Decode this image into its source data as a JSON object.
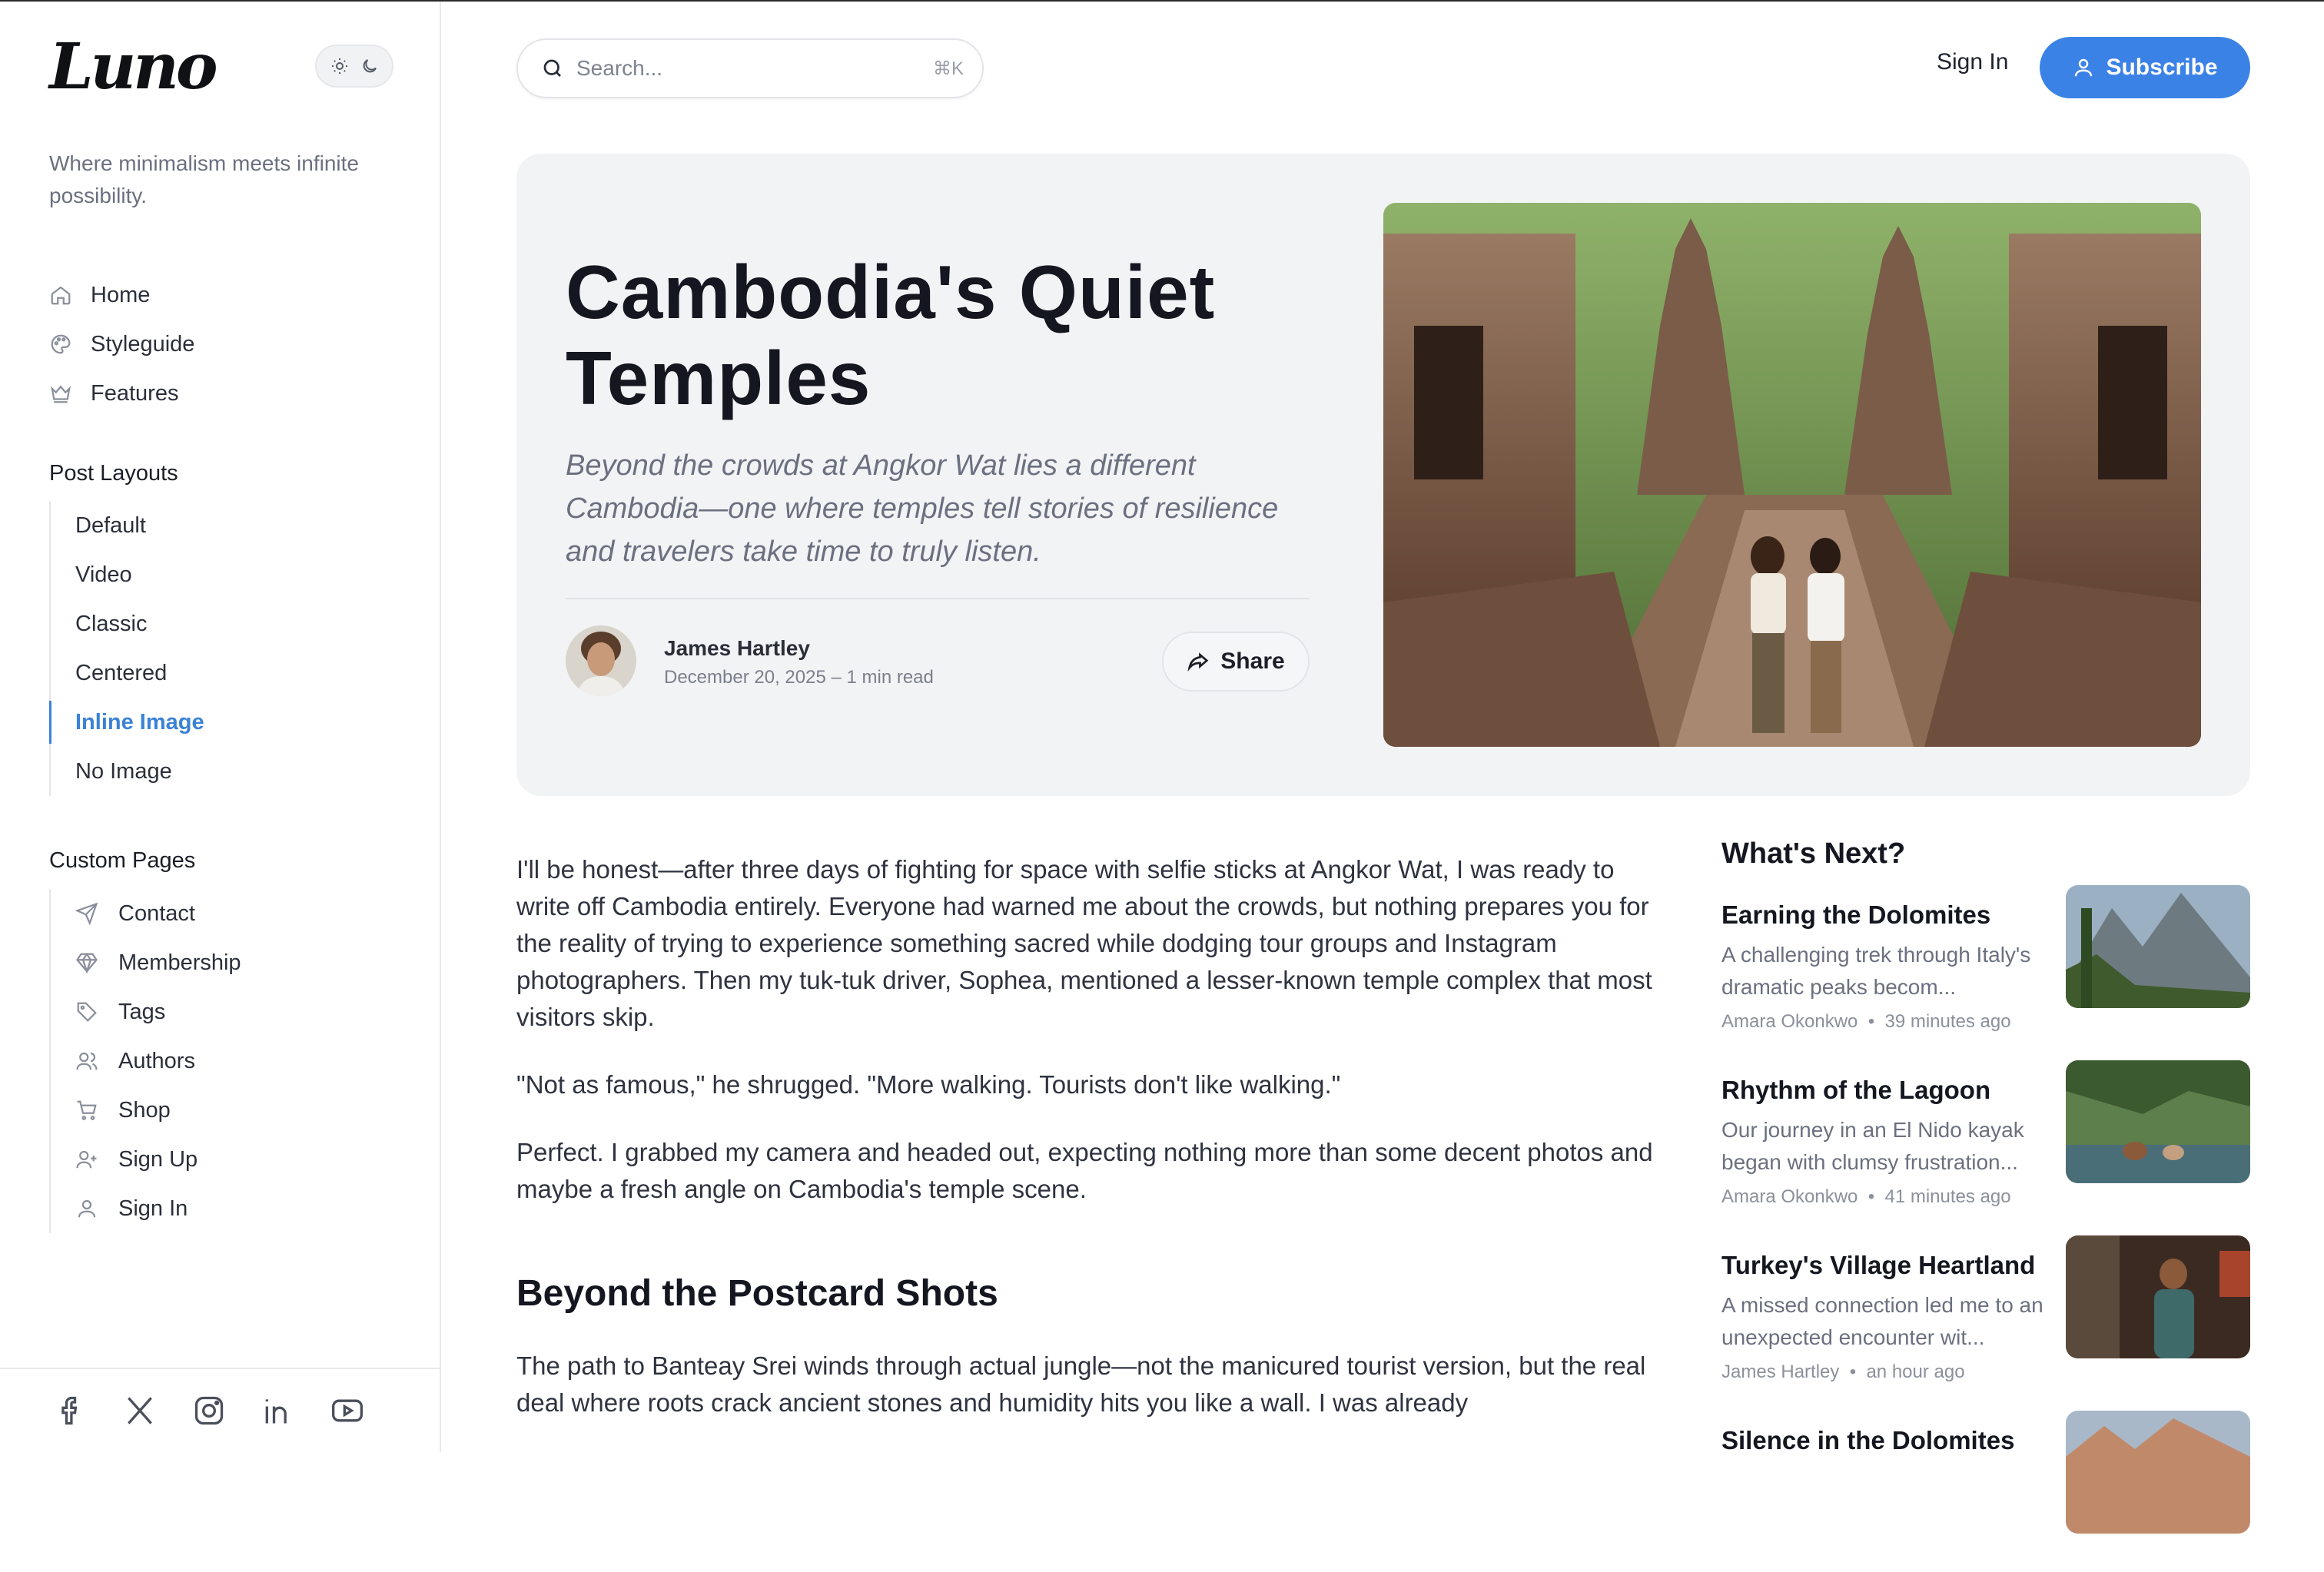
{
  "brand": {
    "logo_text": "Luno",
    "tagline": "Where minimalism meets infinite possibility."
  },
  "sidebar": {
    "main_nav": [
      {
        "label": "Home",
        "icon": "home-icon"
      },
      {
        "label": "Styleguide",
        "icon": "palette-icon"
      },
      {
        "label": "Features",
        "icon": "crown-icon"
      }
    ],
    "post_layouts_title": "Post Layouts",
    "post_layouts": [
      "Default",
      "Video",
      "Classic",
      "Centered",
      "Inline Image",
      "No Image"
    ],
    "active_layout": "Inline Image",
    "custom_pages_title": "Custom Pages",
    "custom_pages": [
      {
        "label": "Contact",
        "icon": "send-icon"
      },
      {
        "label": "Membership",
        "icon": "diamond-icon"
      },
      {
        "label": "Tags",
        "icon": "tag-icon"
      },
      {
        "label": "Authors",
        "icon": "users-icon"
      },
      {
        "label": "Shop",
        "icon": "cart-icon"
      },
      {
        "label": "Sign Up",
        "icon": "user-plus-icon"
      },
      {
        "label": "Sign In",
        "icon": "user-icon"
      }
    ],
    "social": [
      "facebook-icon",
      "x-icon",
      "instagram-icon",
      "linkedin-icon",
      "youtube-icon"
    ]
  },
  "header": {
    "search_placeholder": "Search...",
    "search_shortcut": "⌘K",
    "sign_in": "Sign In",
    "subscribe": "Subscribe"
  },
  "hero": {
    "title": "Cambodia's Quiet Temples",
    "subtitle": "Beyond the crowds at Angkor Wat lies a different Cambodia—one where temples tell stories of resilience and travelers take time to truly listen.",
    "author": "James Hartley",
    "meta": "December 20, 2025 – 1 min read",
    "share": "Share"
  },
  "article": {
    "p1": "I'll be honest—after three days of fighting for space with selfie sticks at Angkor Wat, I was ready to write off Cambodia entirely. Everyone had warned me about the crowds, but nothing prepares you for the reality of trying to experience something sacred while dodging tour groups and Instagram photographers. Then my tuk-tuk driver, Sophea, mentioned a lesser-known temple complex that most visitors skip.",
    "p2": "\"Not as famous,\" he shrugged. \"More walking. Tourists don't like walking.\"",
    "p3": "Perfect. I grabbed my camera and headed out, expecting nothing more than some decent photos and maybe a fresh angle on Cambodia's temple scene.",
    "h2": "Beyond the Postcard Shots",
    "p4": "The path to Banteay Srei winds through actual jungle—not the manicured tourist version, but the real deal where roots crack ancient stones and humidity hits you like a wall. I was already"
  },
  "whats_next": {
    "title": "What's Next?",
    "items": [
      {
        "title": "Earning the Dolomites",
        "desc": "A challenging trek through Italy's dramatic peaks becom...",
        "author": "Amara Okonkwo",
        "time": "39 minutes ago"
      },
      {
        "title": "Rhythm of the Lagoon",
        "desc": "Our journey in an El Nido kayak began with clumsy frustration...",
        "author": "Amara Okonkwo",
        "time": "41 minutes ago"
      },
      {
        "title": "Turkey's Village Heartland",
        "desc": "A missed connection led me to an unexpected encounter wit...",
        "author": "James Hartley",
        "time": "an hour ago"
      },
      {
        "title": "Silence in the Dolomites",
        "desc": "",
        "author": "",
        "time": ""
      }
    ]
  },
  "colors": {
    "accent": "#3b82e6",
    "hero_bg": "#f2f3f5",
    "text": "#1f2330",
    "muted": "#6b7080"
  }
}
